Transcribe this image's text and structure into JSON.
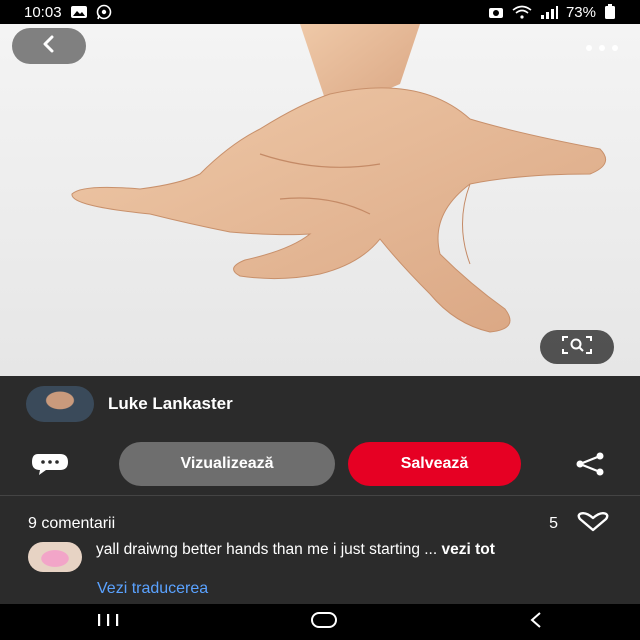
{
  "status_bar": {
    "time": "10:03",
    "battery": "73%",
    "left_icons": [
      "gallery-icon",
      "whatsapp-icon"
    ],
    "right_icons": [
      "camera-icon",
      "wifi-icon",
      "signal-icon",
      "battery-icon"
    ]
  },
  "pin": {
    "image_subject": "hand",
    "back_icon": "chevron-left-icon",
    "more_icon": "more-horizontal-icon",
    "lens_icon": "visual-search-icon"
  },
  "author": {
    "name": "Luke Lankaster"
  },
  "actions": {
    "view_label": "Vizualizează",
    "save_label": "Salvează",
    "comment_icon": "comment-bubble-icon",
    "share_icon": "share-icon"
  },
  "comments": {
    "count_label": "9 comentarii",
    "likes": "5",
    "items": [
      {
        "text": "yall draiwng better hands than me i just starting ...",
        "more": "vezi tot",
        "translate": "Vezi traducerea"
      }
    ]
  },
  "colors": {
    "save_red": "#e60023",
    "view_gray": "#6e6e6e",
    "panel_bg": "#2b2b2b",
    "link_blue": "#5aa2ff"
  }
}
